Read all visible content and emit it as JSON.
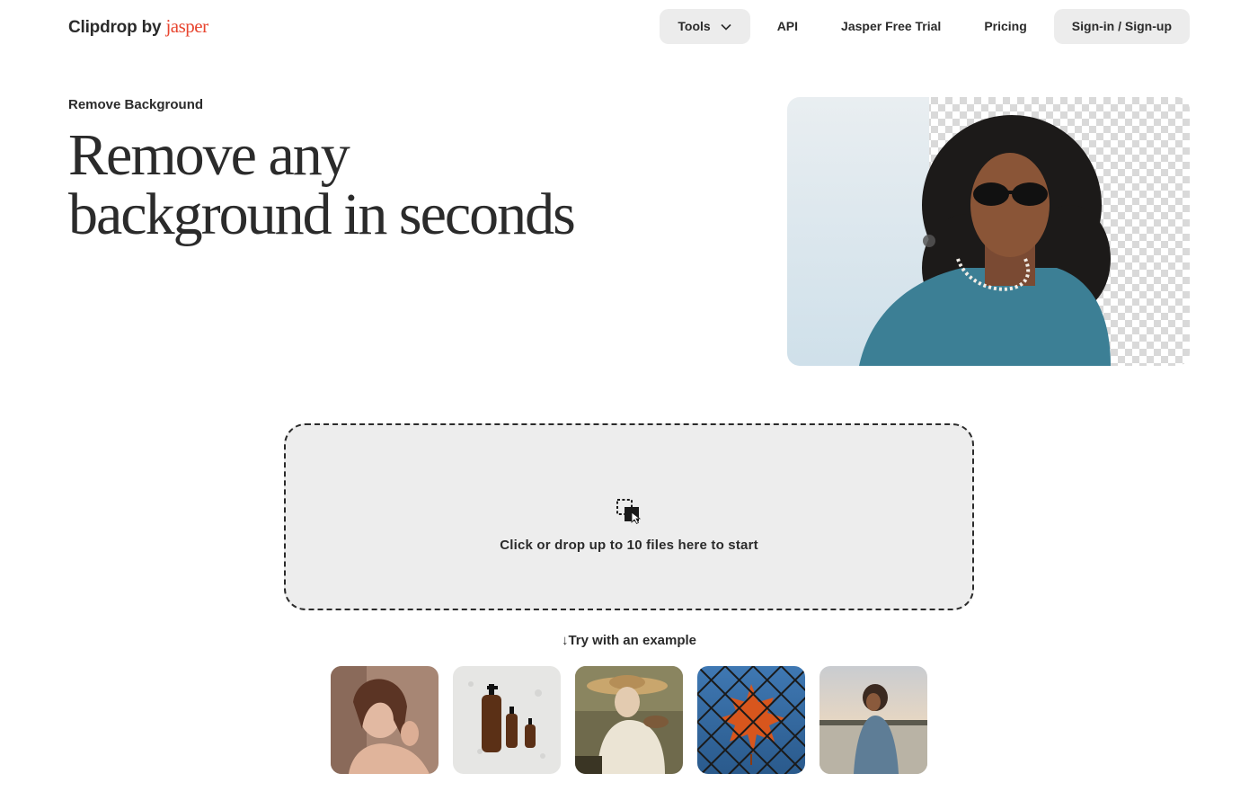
{
  "brand": {
    "name": "Clipdrop",
    "by": "by",
    "partner": "jasper",
    "partner_color": "#e8452f"
  },
  "nav": {
    "tools_label": "Tools",
    "api_label": "API",
    "trial_label": "Jasper Free Trial",
    "pricing_label": "Pricing",
    "signin_label": "Sign-in / Sign-up"
  },
  "hero": {
    "eyebrow": "Remove Background",
    "headline_line1": "Remove any",
    "headline_line2": "background in seconds"
  },
  "dropzone": {
    "icon": "drag-drop-icon",
    "text": "Click or drop up to 10 files here to start"
  },
  "examples": {
    "arrow": "↓",
    "label": "Try with an example",
    "items": [
      "portrait-woman",
      "cosmetic-bottles",
      "painting-woman-hat",
      "autumn-leaf-fence",
      "woman-lake-sunset"
    ]
  },
  "colors": {
    "text": "#2b2b2b",
    "surface": "#ececec",
    "accent": "#e8452f"
  }
}
